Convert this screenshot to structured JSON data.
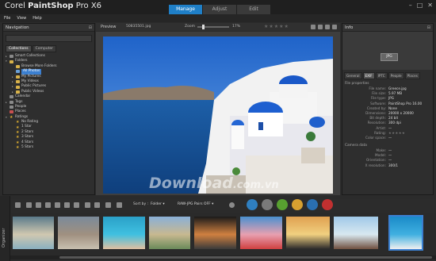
{
  "app": {
    "title_prefix": "Corel ",
    "title_bold": "PaintShop",
    "title_suffix": " Pro X6",
    "window_controls": [
      "–",
      "□",
      "✕"
    ]
  },
  "mode_tabs": [
    {
      "label": "Manage",
      "active": true
    },
    {
      "label": "Adjust",
      "active": false
    },
    {
      "label": "Edit",
      "active": false
    }
  ],
  "menu": [
    "File",
    "View",
    "Help"
  ],
  "navigation": {
    "title": "Navigation",
    "tabs": [
      {
        "label": "Collections",
        "active": true
      },
      {
        "label": "Computer",
        "active": false
      }
    ],
    "tree": [
      {
        "label": "Smart Collections",
        "icon": "gray",
        "arrow": "▸"
      },
      {
        "label": "Folders",
        "icon": "folder",
        "arrow": "▾"
      },
      {
        "label": "Browse More Folders",
        "icon": "folder",
        "arrow": ""
      },
      {
        "label": "All Photos",
        "icon": "blue",
        "arrow": "",
        "selected": true
      },
      {
        "label": "My Pictures",
        "icon": "folder",
        "arrow": "▸"
      },
      {
        "label": "My Videos",
        "icon": "folder",
        "arrow": "▸"
      },
      {
        "label": "Public Pictures",
        "icon": "folder",
        "arrow": "▸"
      },
      {
        "label": "Public Videos",
        "icon": "folder",
        "arrow": "▸"
      },
      {
        "label": "Calendar",
        "icon": "gray",
        "arrow": ""
      },
      {
        "label": "Tags",
        "icon": "gray",
        "arrow": "▸"
      },
      {
        "label": "People",
        "icon": "gray",
        "arrow": ""
      },
      {
        "label": "Places",
        "icon": "red",
        "arrow": ""
      },
      {
        "label": "Ratings",
        "icon": "star",
        "arrow": "▾"
      },
      {
        "label": "No Rating",
        "icon": "star",
        "arrow": ""
      },
      {
        "label": "1 Star",
        "icon": "star",
        "arrow": ""
      },
      {
        "label": "2 Stars",
        "icon": "star",
        "arrow": ""
      },
      {
        "label": "3 Stars",
        "icon": "star",
        "arrow": ""
      },
      {
        "label": "4 Stars",
        "icon": "star",
        "arrow": ""
      },
      {
        "label": "5 Stars",
        "icon": "star",
        "arrow": ""
      }
    ]
  },
  "preview": {
    "label": "Preview",
    "filename": "50835501.jpg",
    "zoom_label": "Zoom",
    "zoom_value": "17%",
    "zoom_fraction": 0.17,
    "stars": "★★★★★"
  },
  "watermark": {
    "main": "Download",
    "domain": ".com.vn"
  },
  "info": {
    "title": "Info",
    "format_badge": "JPG",
    "tabs": [
      {
        "label": "General",
        "active": false
      },
      {
        "label": "EXIF",
        "active": true
      },
      {
        "label": "IPTC",
        "active": false
      },
      {
        "label": "People",
        "active": false
      },
      {
        "label": "Places",
        "active": false
      }
    ],
    "file_section": "File properties",
    "file_props": [
      {
        "key": "File name:",
        "value": "Greece.jpg"
      },
      {
        "key": "File size:",
        "value": "5.97 MB"
      },
      {
        "key": "File type:",
        "value": "JPG"
      },
      {
        "key": "Software:",
        "value": "PaintShop Pro 16.00"
      },
      {
        "key": "Created by:",
        "value": "None"
      },
      {
        "key": "Dimensions:",
        "value": "20000 x 20000"
      },
      {
        "key": "Bit depth:",
        "value": "24 bit"
      },
      {
        "key": "Resolution:",
        "value": "300 dpi"
      },
      {
        "key": "Artist:",
        "value": "—"
      },
      {
        "key": "Rating:",
        "value": "★★★★★",
        "type": "stars"
      },
      {
        "key": "Color space:",
        "value": "—"
      }
    ],
    "camera_section": "Camera data",
    "camera_props": [
      {
        "key": "Make:",
        "value": "—"
      },
      {
        "key": "Model:",
        "value": "—"
      },
      {
        "key": "Orientation:",
        "value": "—"
      },
      {
        "key": "X resolution:",
        "value": "300/1"
      }
    ]
  },
  "organizer": {
    "label": "Organizer",
    "sort_label": "Sort by :",
    "sort_value": "Folder ▾",
    "raw_filter": "RAW-JPG Pairs OFF ▾",
    "swatches": [
      "#2f7fc0",
      "#7a7a7a",
      "#58a030",
      "#d7a030",
      "#2a6fb0",
      "#c03030"
    ],
    "thumbnails": [
      "wave",
      "rocks",
      "pool",
      "ruins",
      "deck",
      "harbor",
      "yoga",
      "sky",
      "boat"
    ]
  }
}
